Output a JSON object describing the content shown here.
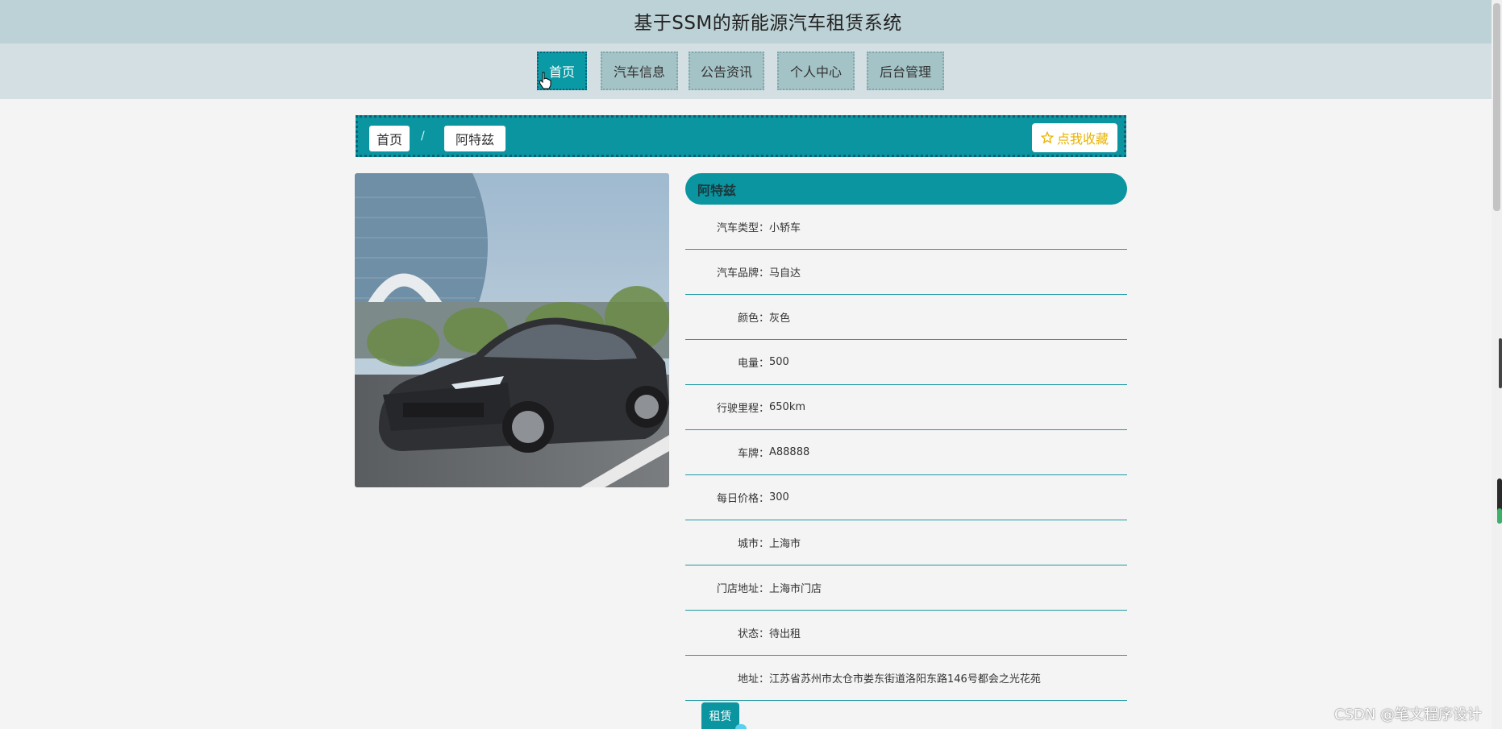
{
  "app": {
    "title": "基于SSM的新能源汽车租赁系统"
  },
  "nav": {
    "items": [
      {
        "label": "首页",
        "active": true
      },
      {
        "label": "汽车信息",
        "active": false
      },
      {
        "label": "公告资讯",
        "active": false
      },
      {
        "label": "个人中心",
        "active": false
      },
      {
        "label": "后台管理",
        "active": false
      }
    ]
  },
  "breadcrumb": {
    "home": "首页",
    "separator": "/",
    "current": "阿特兹"
  },
  "favorite": {
    "icon": "star-outline-icon",
    "label": "点我收藏"
  },
  "car": {
    "name": "阿特兹",
    "image_alt": "dark grey sedan car photo",
    "fields": [
      {
        "label": "汽车类型：",
        "value": "小轿车"
      },
      {
        "label": "汽车品牌：",
        "value": "马自达"
      },
      {
        "label": "颜色：",
        "value": "灰色"
      },
      {
        "label": "电量：",
        "value": "500"
      },
      {
        "label": "行驶里程：",
        "value": "650km"
      },
      {
        "label": "车牌：",
        "value": "A88888"
      },
      {
        "label": "每日价格：",
        "value": "300"
      },
      {
        "label": "城市：",
        "value": "上海市"
      },
      {
        "label": "门店地址：",
        "value": "上海市门店"
      },
      {
        "label": "状态：",
        "value": "待出租"
      },
      {
        "label": "地址：",
        "value": "江苏省苏州市太仓市娄东街道洛阳东路146号都会之光花苑"
      }
    ]
  },
  "actions": {
    "rent_label": "租赁"
  },
  "watermark": "CSDN @笔文程序设计",
  "colors": {
    "accent": "#0a95a1",
    "topbar": "#bdd2d6",
    "navbar": "#d3dfe3",
    "favorite": "#e8b300"
  }
}
